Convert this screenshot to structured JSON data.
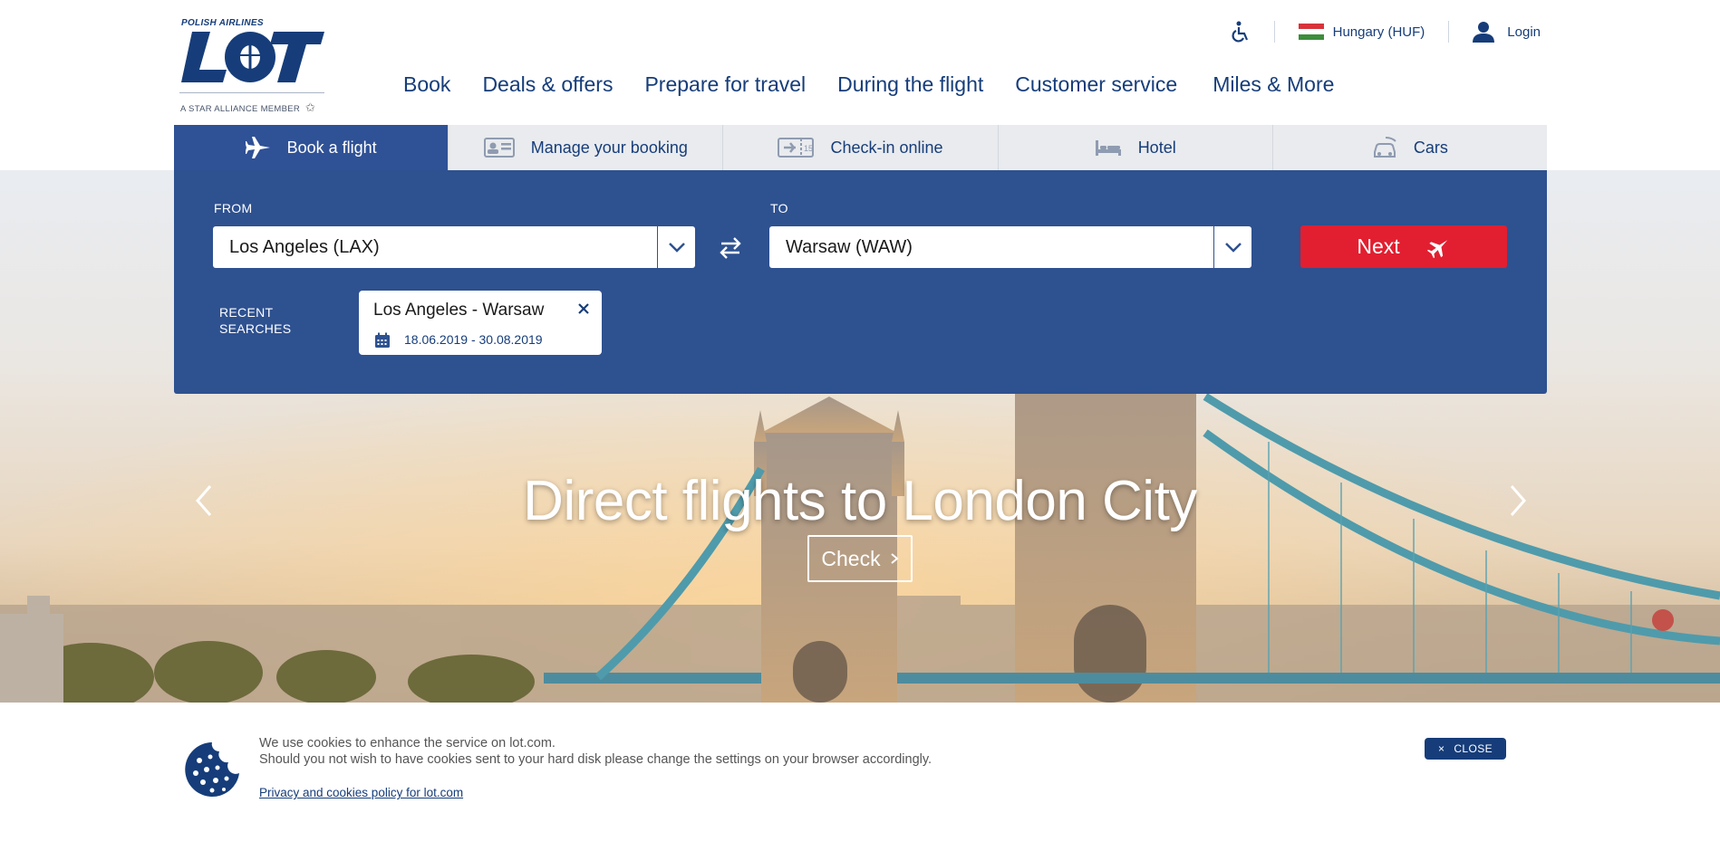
{
  "colors": {
    "brand_navy": "#163d7a",
    "panel_blue": "#2e5190",
    "next_red": "#e11f30"
  },
  "logo": {
    "tagline": "POLISH AIRLINES",
    "wordmark": "LOT",
    "alliance": "A STAR ALLIANCE MEMBER"
  },
  "topbar": {
    "accessibility_icon": "wheelchair-icon",
    "country": "Hungary (HUF)",
    "login": "Login"
  },
  "main_nav": [
    "Book",
    "Deals & offers",
    "Prepare for travel",
    "During the flight",
    "Customer service",
    "Miles & More"
  ],
  "tabs": [
    {
      "label": "Book a flight",
      "icon": "plane-icon",
      "active": true
    },
    {
      "label": "Manage your booking",
      "icon": "id-card-icon",
      "active": false
    },
    {
      "label": "Check-in online",
      "icon": "boarding-pass-icon",
      "active": false
    },
    {
      "label": "Hotel",
      "icon": "bed-icon",
      "active": false
    },
    {
      "label": "Cars",
      "icon": "car-icon",
      "active": false
    }
  ],
  "search": {
    "from_label": "FROM",
    "from_value": "Los Angeles (LAX)",
    "to_label": "TO",
    "to_value": "Warsaw (WAW)",
    "next_label": "Next",
    "recent_label_1": "RECENT",
    "recent_label_2": "SEARCHES",
    "recent_route": "Los Angeles - Warsaw",
    "recent_dates": "18.06.2019 - 30.08.2019"
  },
  "hero": {
    "title": "Direct flights to London City",
    "button": "Check"
  },
  "cookie": {
    "line1": "We use cookies to enhance the service on lot.com.",
    "line2": "Should you not wish to have cookies sent to your hard disk please change the settings on your browser accordingly.",
    "policy_link": "Privacy and cookies policy for lot.com",
    "close_label": "CLOSE"
  }
}
